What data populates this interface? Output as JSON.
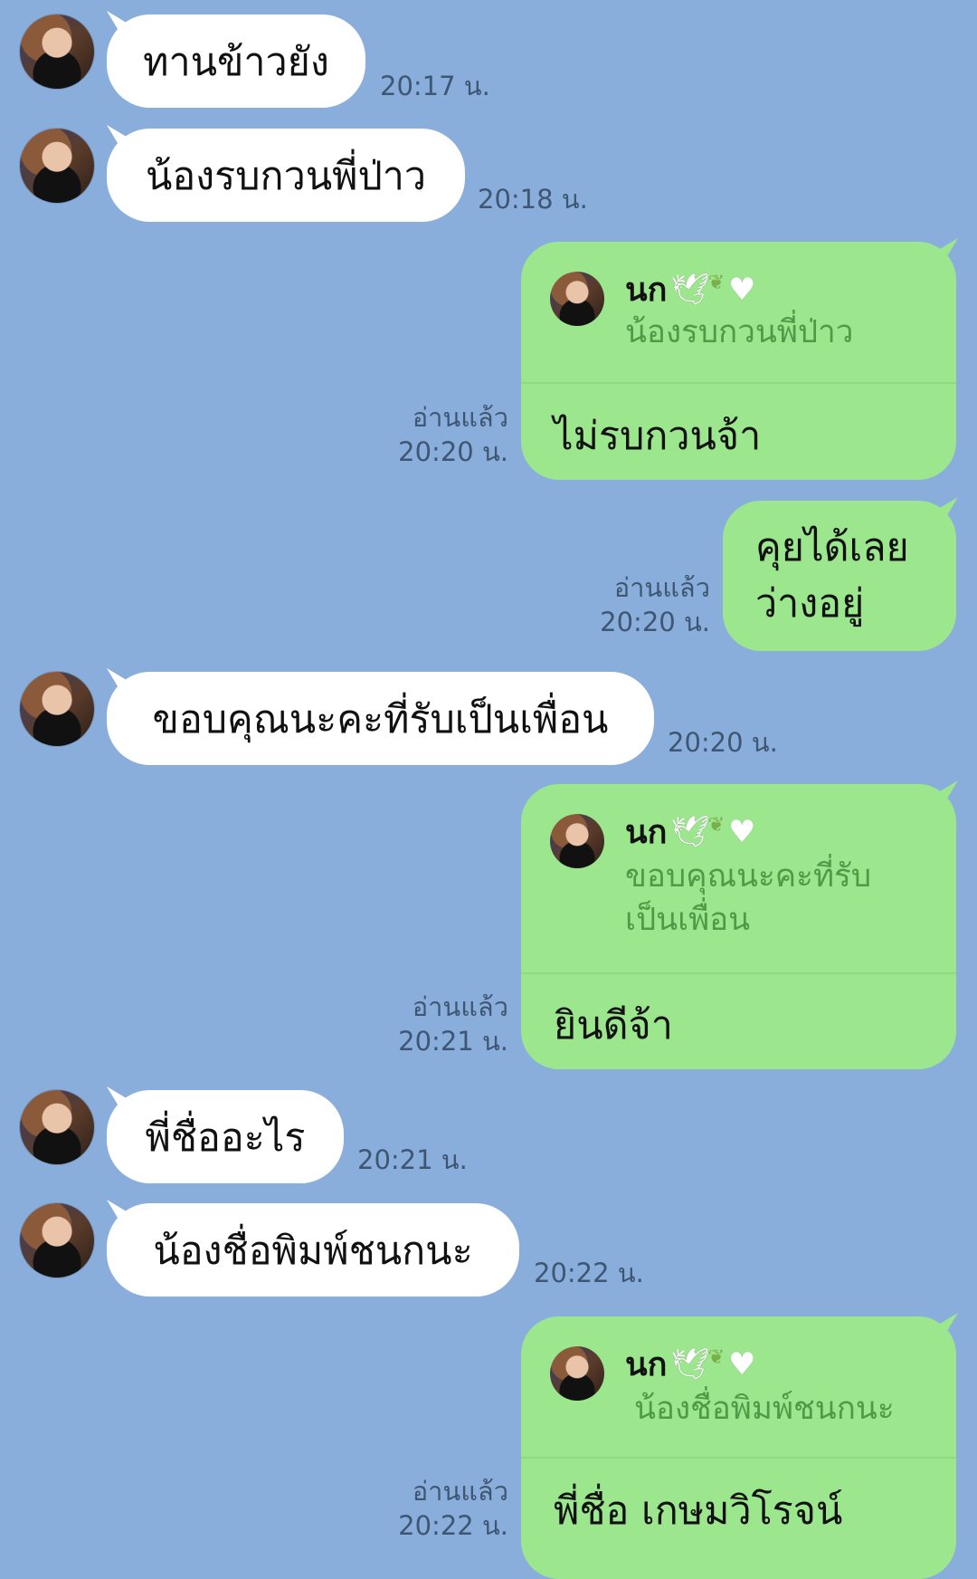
{
  "conversation": {
    "messages": [
      {
        "kind": "in",
        "text": "ทานข้าวยัง",
        "time": "20:17 น."
      },
      {
        "kind": "in",
        "text": "น้องรบกวนพี่ป่าว",
        "time": "20:18 น."
      },
      {
        "kind": "out-reply",
        "reply_to_name": "นก",
        "reply_to_text": "น้องรบกวนพี่ป่าว",
        "text": "ไม่รบกวนจ้า",
        "read": "อ่านแล้ว",
        "time": "20:20 น."
      },
      {
        "kind": "out",
        "text_line1": "คุยได้เลย",
        "text_line2": "ว่างอยู่",
        "read": "อ่านแล้ว",
        "time": "20:20 น."
      },
      {
        "kind": "in",
        "text": "ขอบคุณนะคะที่รับเป็นเพื่อน",
        "time": "20:20 น."
      },
      {
        "kind": "out-reply",
        "reply_to_name": "นก",
        "reply_to_text_line1": "ขอบคุณนะคะที่รับ",
        "reply_to_text_line2": "เป็นเพื่อน",
        "text": "ยินดีจ้า",
        "read": "อ่านแล้ว",
        "time": "20:21 น."
      },
      {
        "kind": "in",
        "text": "พี่ชื่ออะไร",
        "time": "20:21 น."
      },
      {
        "kind": "in",
        "text": "น้องชื่อพิมพ์ชนกนะ",
        "time": "20:22 น."
      },
      {
        "kind": "out-reply",
        "reply_to_name": "นก",
        "reply_to_text": "น้องชื่อพิมพ์ชนกนะ",
        "text": "พี่ชื่อ เกษมวิโรจน์",
        "read": "อ่านแล้ว",
        "time": "20:22 น."
      }
    ]
  },
  "icons": {
    "dove": "dove-icon",
    "leaf": "olive-branch-icon",
    "heart": "white-heart-icon"
  },
  "colors": {
    "background": "#8aaedc",
    "incoming_bubble": "#ffffff",
    "outgoing_bubble": "#9ce68e",
    "quote_text": "#4f9a47"
  }
}
